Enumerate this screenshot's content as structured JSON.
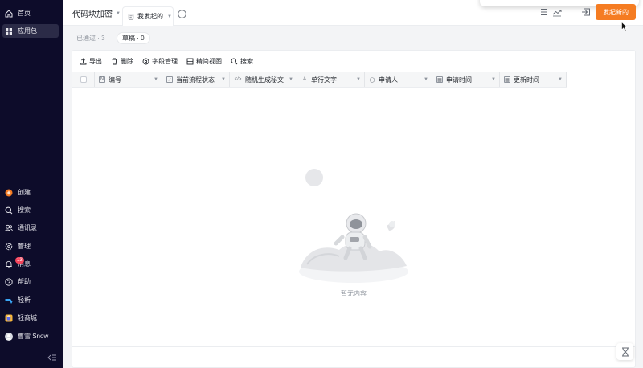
{
  "sidebar": {
    "top_items": [
      {
        "label": "首页",
        "icon": "home-icon"
      },
      {
        "label": "应用包",
        "icon": "grid-icon",
        "active": true
      }
    ],
    "bottom_items": [
      {
        "label": "创建",
        "icon": "plus-circle-icon"
      },
      {
        "label": "搜索",
        "icon": "search-icon"
      },
      {
        "label": "通讯录",
        "icon": "contacts-icon"
      },
      {
        "label": "管理",
        "icon": "gear-icon"
      },
      {
        "label": "消息",
        "icon": "bell-icon",
        "badge": "13"
      },
      {
        "label": "帮助",
        "icon": "help-icon"
      },
      {
        "label": "轻析",
        "icon": "analytics-icon"
      },
      {
        "label": "轻商城",
        "icon": "store-icon"
      },
      {
        "label": "曹雪 Snow",
        "icon": "avatar-icon"
      }
    ]
  },
  "header": {
    "app_title": "代码块加密",
    "tab_label": "我发起的",
    "primary_button": "发起新的"
  },
  "filters": {
    "passed": "已通过 · 3",
    "draft": "草稿 · 0"
  },
  "toolbar": {
    "export": "导出",
    "delete": "删除",
    "fields": "字段管理",
    "view": "精简视图",
    "search": "搜索"
  },
  "table": {
    "columns": [
      {
        "label": "编号",
        "icon": "N"
      },
      {
        "label": "当前流程状态",
        "icon": "✓"
      },
      {
        "label": "随机生成秘文",
        "icon": "</>"
      },
      {
        "label": "单行文字",
        "icon": "A"
      },
      {
        "label": "申请人",
        "icon": "◯"
      },
      {
        "label": "申请时间",
        "icon": "▦"
      },
      {
        "label": "更新时间",
        "icon": "▦"
      }
    ],
    "empty_text": "暂无内容"
  },
  "colors": {
    "sidebar_bg": "#0d0c2a",
    "accent": "#f57c22",
    "badge": "#f5455c"
  }
}
